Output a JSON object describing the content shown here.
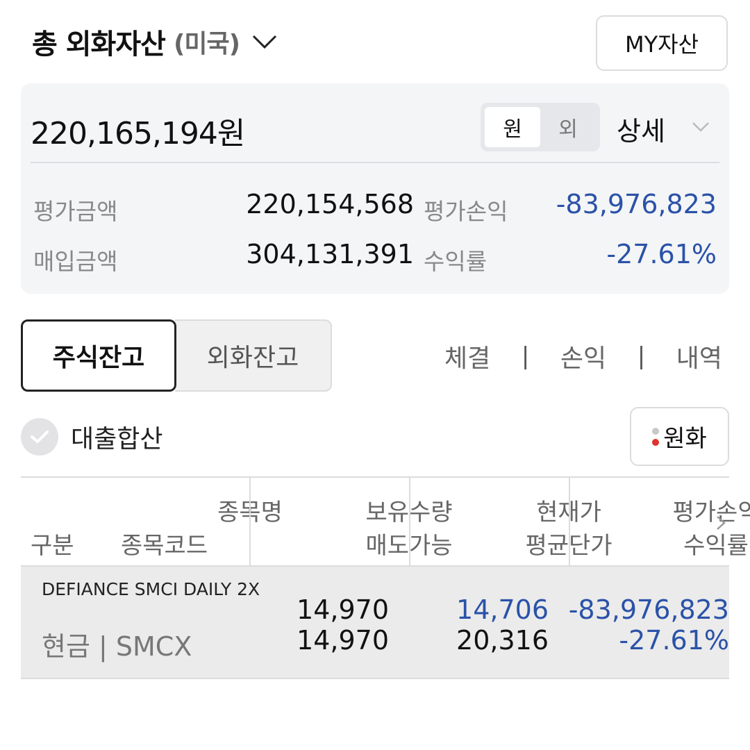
{
  "header": {
    "title": "총 외화자산",
    "region": "(미국)",
    "my_assets_button": "MY자산"
  },
  "summary": {
    "total": "220,165,194원",
    "currency_toggle": [
      "원",
      "외"
    ],
    "currency_toggle_selected": "원",
    "detail_label": "상세",
    "rows": [
      {
        "label": "평가금액",
        "value": "220,154,568",
        "label2": "평가손익",
        "value2": "-83,976,823"
      },
      {
        "label": "매입금액",
        "value": "304,131,391",
        "label2": "수익률",
        "value2": "-27.61%"
      }
    ]
  },
  "tabs": [
    {
      "label": "주식잔고",
      "active": true
    },
    {
      "label": "외화잔고",
      "active": false
    }
  ],
  "links": [
    "체결",
    "손익",
    "내역"
  ],
  "link_separator": "|",
  "loan_combine": {
    "label": "대출합산",
    "checked": false
  },
  "currency_button": {
    "label": "원화"
  },
  "table": {
    "headers": {
      "col1_top": "종목명",
      "col1_bottom_left": "구분",
      "col1_bottom_right": "종목코드",
      "col2_top": "보유수량",
      "col2_bottom": "매도가능",
      "col3_top": "현재가",
      "col3_bottom": "평균단가",
      "col4_top": "평가손익",
      "col4_bottom": "수익률"
    },
    "rows": [
      {
        "name": "DEFIANCE SMCI DAILY 2X",
        "type_code": "현금 | SMCX",
        "holding_qty": "14,970",
        "sellable_qty": "14,970",
        "current_price": "14,706",
        "avg_price": "20,316",
        "pnl": "-83,976,823",
        "return_rate": "-27.61%"
      }
    ]
  },
  "colors": {
    "negative_blue": "#2a52a8",
    "label_gray": "#888888",
    "card_bg": "#f4f5f7",
    "dot_gray": "#c8c8c8",
    "dot_red": "#e0322e"
  }
}
